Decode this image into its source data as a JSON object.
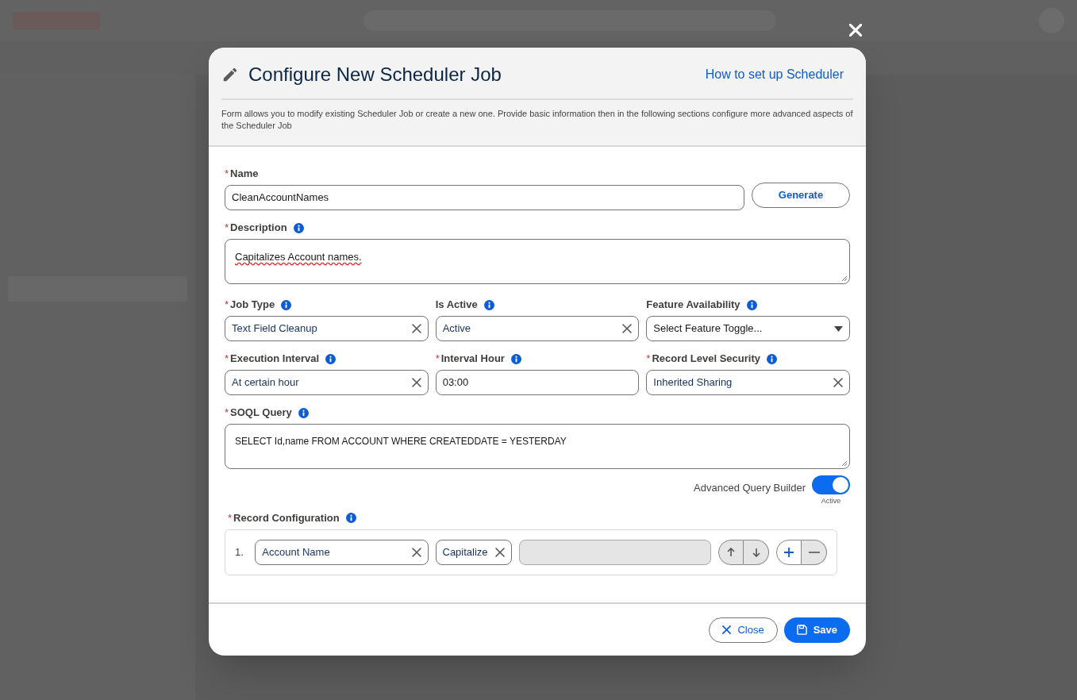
{
  "dialog": {
    "title": "Configure New Scheduler Job",
    "help_link": "How to set up Scheduler",
    "description": "Form allows you to modify existing Scheduler Job or create a new one. Provide basic information then in the following sections configure more advanced aspects of the Scheduler Job"
  },
  "name_field": {
    "label": "Name",
    "required_mark": "*",
    "value": "CleanAccountNames"
  },
  "generate_button": "Generate",
  "description_field": {
    "label": "Description",
    "required_mark": "*",
    "info": true,
    "value": "Capitalizes Account names.",
    "misspelled": true
  },
  "grid_fields": [
    {
      "label": "Job Type",
      "required_mark": "*",
      "info": true,
      "kind": "select",
      "value": "Text Field Cleanup"
    },
    {
      "label": "Is Active",
      "info": true,
      "kind": "select",
      "value": "Active"
    },
    {
      "label": "Feature Availability",
      "info": true,
      "kind": "dropdown",
      "placeholder": "Select Feature Toggle..."
    },
    {
      "label": "Execution Interval",
      "required_mark": "*",
      "info": true,
      "kind": "select",
      "value": "At certain hour"
    },
    {
      "label": "Interval Hour",
      "required_mark": "*",
      "info": true,
      "kind": "text",
      "value": "03:00"
    },
    {
      "label": "Record Level Security",
      "required_mark": "*",
      "info": true,
      "kind": "select",
      "value": "Inherited Sharing"
    }
  ],
  "soql_field": {
    "label": "SOQL Query",
    "required_mark": "*",
    "info": true,
    "value": "SELECT Id,name FROM ACCOUNT WHERE CREATEDDATE = YESTERDAY"
  },
  "query_builder_toggle": {
    "label": "Advanced Query Builder",
    "on": true,
    "status": "Active"
  },
  "record_configuration": {
    "label": "Record Configuration",
    "required_mark": "*",
    "info": true,
    "rows": [
      {
        "number": "1.",
        "field": "Account Name",
        "action": "Capitalize",
        "extra_disabled": true
      }
    ]
  },
  "footer_buttons": [
    {
      "label": "Close",
      "kind": "secondary"
    },
    {
      "label": "Save",
      "kind": "primary"
    }
  ]
}
